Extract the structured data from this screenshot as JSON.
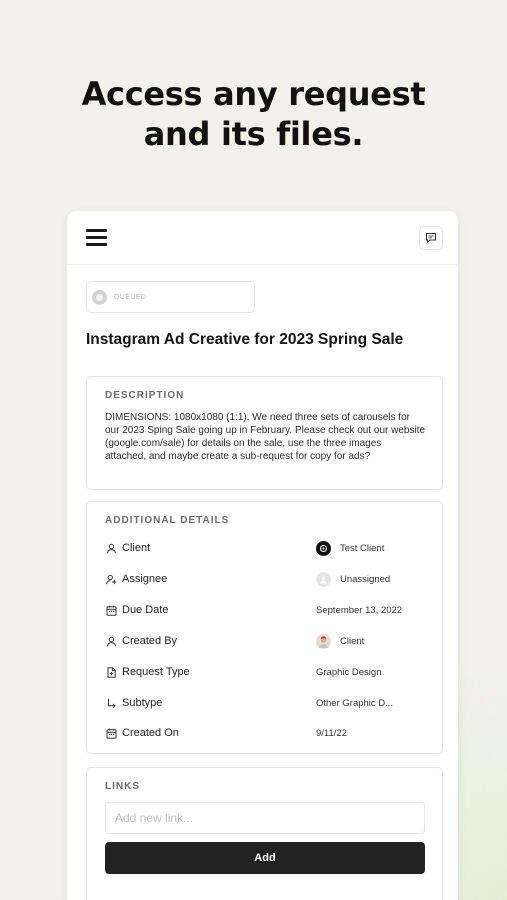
{
  "headline": {
    "line1": "Access any request",
    "line2": "and its files."
  },
  "status": {
    "label": "QUEUED"
  },
  "request": {
    "title": "Instagram Ad Creative for 2023 Spring Sale"
  },
  "description": {
    "heading": "DESCRIPTION",
    "text": "DIMENSIONS: 1080x1080 (1:1). We need three sets of carousels for our 2023 Sping Sale going up in February. Please check out our website (google.com/sale) for details on the sale, use the three images attached, and maybe create a sub-request for copy for ads?"
  },
  "details": {
    "heading": "ADDITIONAL DETAILS",
    "rows": [
      {
        "icon": "user-icon",
        "key": "Client",
        "value": "Test Client"
      },
      {
        "icon": "user-plus-icon",
        "key": "Assignee",
        "value": "Unassigned"
      },
      {
        "icon": "calendar-icon",
        "key": "Due Date",
        "value": "September 13, 2022"
      },
      {
        "icon": "user-icon",
        "key": "Created By",
        "value": "Client"
      },
      {
        "icon": "document-icon",
        "key": "Request Type",
        "value": "Graphic Design"
      },
      {
        "icon": "subdirectory-arrow-icon",
        "key": "Subtype",
        "value": "Other Graphic D..."
      },
      {
        "icon": "calendar-icon",
        "key": "Created On",
        "value": "9/11/22"
      }
    ]
  },
  "links": {
    "heading": "LINKS",
    "placeholder": "Add new link...",
    "add_label": "Add"
  },
  "colors": {
    "background": "#f2f1ed",
    "button": "#222222",
    "card": "#ffffff"
  }
}
